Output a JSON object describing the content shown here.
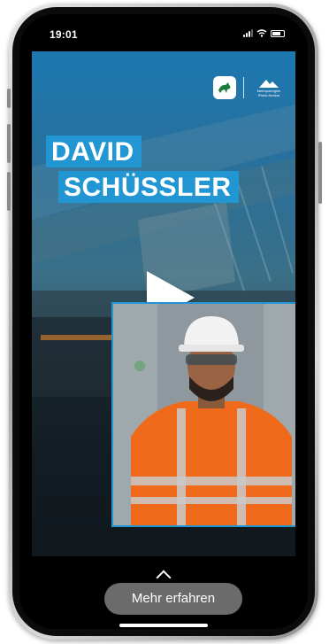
{
  "status_bar": {
    "time": "19:01"
  },
  "video": {
    "name_line_1": "DAVID",
    "name_line_2": "SCHÜSSLER",
    "brand_icon": "john-deere-icon",
    "partner_logo_text": "Metropolregion\nRhein-Neckar",
    "play_icon": "play-icon",
    "accent_color": "#2196d3"
  },
  "footer": {
    "more_button_label": "Mehr erfahren",
    "chevron_icon": "chevron-up-icon"
  }
}
